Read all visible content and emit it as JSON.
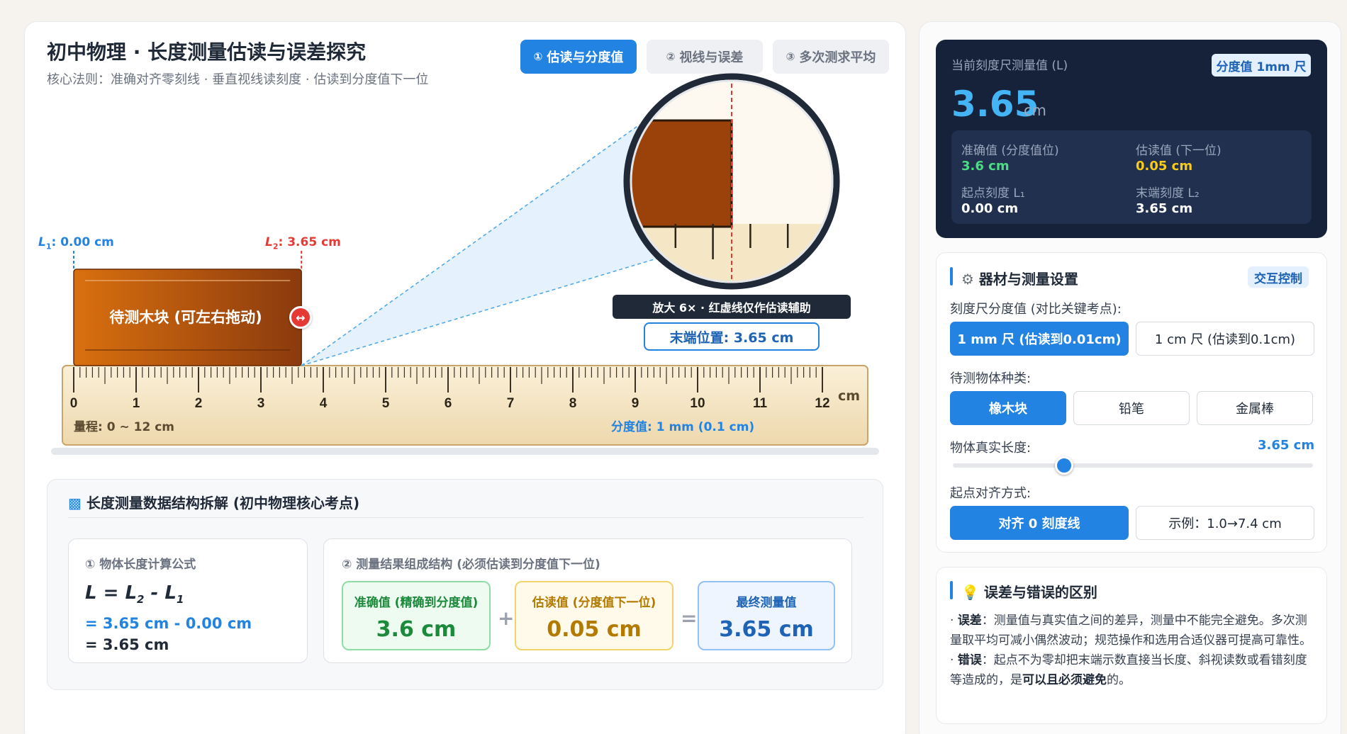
{
  "header": {
    "title": "初中物理 · 长度测量估读与误差探究",
    "subtitle": "核心法则：准确对齐零刻线 · 垂直视线读刻度 · 估读到分度值下一位"
  },
  "tabs": [
    {
      "num": "①",
      "label": "估读与分度值"
    },
    {
      "num": "②",
      "label": "视线与误差"
    },
    {
      "num": "③",
      "label": "多次测求平均"
    }
  ],
  "scene": {
    "l1_prefix": "L",
    "l1_sub": "1",
    "l1_value": ": 0.00 cm",
    "l2_prefix": "L",
    "l2_sub": "2",
    "l2_value": ": 3.65 cm",
    "block_label": "待测木块 (可左右拖动)",
    "drag_icon": "↔",
    "ruler_ticks": [
      "0",
      "1",
      "2",
      "3",
      "4",
      "5",
      "6",
      "7",
      "8",
      "9",
      "10",
      "11",
      "12"
    ],
    "ruler_unit": "cm",
    "ruler_range": "量程: 0 ~ 12 cm",
    "ruler_division": "分度值: 1 mm (0.1 cm)",
    "magnifier_caption": "放大 6× · 红虚线仅作估读辅助",
    "magnifier_end": "末端位置:  3.65 cm",
    "block_length_cm": 3.65,
    "block_start_cm": 0.0,
    "ruler_max_cm": 12,
    "magnification": 6
  },
  "breakdown": {
    "title": "长度测量数据结构拆解 (初中物理核心考点)",
    "title_icon": "bar-chart-icon",
    "formula_card": {
      "head": "① 物体长度计算公式",
      "formula_L": "L",
      "formula_eq": " = ",
      "formula_L2": "L",
      "formula_sub2": "2",
      "formula_minus": " - ",
      "formula_L1": "L",
      "formula_sub1": "1",
      "substitution": "= 3.65 cm - 0.00 cm",
      "result": "= 3.65 cm"
    },
    "struct_card": {
      "head": "② 测量结果组成结构 (必须估读到分度值下一位)",
      "accurate_label": "准确值 (精确到分度值)",
      "accurate_value": "3.6 cm",
      "estimate_label": "估读值 (分度值下一位)",
      "estimate_value": "0.05 cm",
      "final_label": "最终测量值",
      "final_value": "3.65 cm",
      "plus": "+",
      "equals": "="
    }
  },
  "readout": {
    "label": "当前刻度尺测量值 (L)",
    "badge": "分度值 1mm 尺",
    "value": "3.65",
    "unit": "cm",
    "accurate_label": "准确值 (分度值位)",
    "accurate_value": "3.6 cm",
    "estimate_label": "估读值 (下一位)",
    "estimate_value": "0.05 cm",
    "start_label": "起点刻度 L₁",
    "start_value": "0.00 cm",
    "end_label": "末端刻度 L₂",
    "end_value": "3.65 cm"
  },
  "settings": {
    "title": "器材与测量设置",
    "title_icon": "gear-icon",
    "badge": "交互控制",
    "ruler_label": "刻度尺分度值 (对比关键考点):",
    "ruler_options": [
      "1 mm 尺 (估读到0.01cm)",
      "1 cm 尺 (估读到0.1cm)"
    ],
    "object_label": "待测物体种类:",
    "object_options": [
      "橡木块",
      "铅笔",
      "金属棒"
    ],
    "length_label": "物体真实长度:",
    "length_value": "3.65 cm",
    "length_fraction": 0.31,
    "align_label": "起点对齐方式:",
    "align_options": [
      "对齐 0 刻度线",
      "示例：1.0→7.4 cm"
    ]
  },
  "errors": {
    "title": "误差与错误的区别",
    "title_icon": "lightbulb-icon",
    "bullet": "·",
    "item1_term": "误差",
    "item1_text": "：测量值与真实值之间的差异，测量中不能完全避免。多次测量取平均可减小偶然波动；规范操作和选用合适仪器可提高可靠性。",
    "item2_term": "错误",
    "item2_text": "：起点不为零却把末端示数直接当长度、斜视读数或看错刻度等造成的，是",
    "item2_strong": "可以且必须避免",
    "item2_end": "的。"
  },
  "colors": {
    "accent": "#2383e2",
    "red": "#e53935",
    "dark": "#16213a",
    "wood_dark": "#8b3a0e",
    "wood_light": "#d9700f"
  }
}
